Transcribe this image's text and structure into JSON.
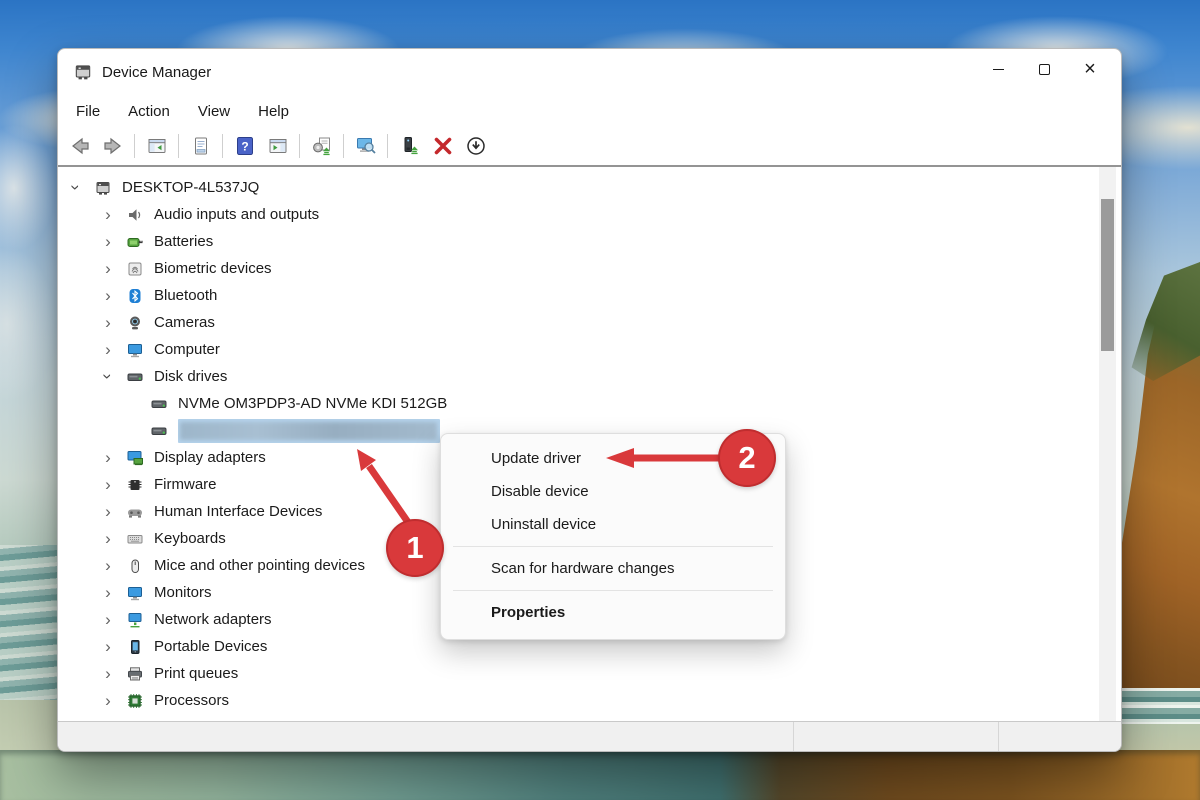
{
  "window": {
    "title": "Device Manager",
    "controls": [
      {
        "name": "minimize"
      },
      {
        "name": "maximize"
      },
      {
        "name": "close"
      }
    ]
  },
  "menu_bar": {
    "items": [
      {
        "label": "File"
      },
      {
        "label": "Action"
      },
      {
        "label": "View"
      },
      {
        "label": "Help"
      }
    ]
  },
  "toolbar": {
    "items": [
      {
        "type": "button",
        "icon": "back-icon"
      },
      {
        "type": "button",
        "icon": "forward-icon"
      },
      {
        "type": "separator"
      },
      {
        "type": "button",
        "icon": "show-console-tree-icon"
      },
      {
        "type": "separator"
      },
      {
        "type": "button",
        "icon": "properties-icon"
      },
      {
        "type": "separator"
      },
      {
        "type": "button",
        "icon": "help-icon"
      },
      {
        "type": "button",
        "icon": "action-pane-icon"
      },
      {
        "type": "separator"
      },
      {
        "type": "button",
        "icon": "update-driver-software-icon"
      },
      {
        "type": "separator"
      },
      {
        "type": "button",
        "icon": "scan-hardware-changes-icon"
      },
      {
        "type": "separator"
      },
      {
        "type": "button",
        "icon": "update-device-driver-icon"
      },
      {
        "type": "button",
        "icon": "uninstall-device-icon"
      },
      {
        "type": "button",
        "icon": "disable-device-icon"
      }
    ]
  },
  "device_tree": {
    "items": [
      {
        "label": "DESKTOP-4L537JQ",
        "level": 0,
        "icon": "computer-host-icon",
        "state": "expanded"
      },
      {
        "label": "Audio inputs and outputs",
        "level": 1,
        "icon": "audio-icon",
        "state": "collapsed"
      },
      {
        "label": "Batteries",
        "level": 1,
        "icon": "battery-icon",
        "state": "collapsed"
      },
      {
        "label": "Biometric devices",
        "level": 1,
        "icon": "biometric-icon",
        "state": "collapsed"
      },
      {
        "label": "Bluetooth",
        "level": 1,
        "icon": "bluetooth-icon",
        "state": "collapsed"
      },
      {
        "label": "Cameras",
        "level": 1,
        "icon": "camera-icon",
        "state": "collapsed"
      },
      {
        "label": "Computer",
        "level": 1,
        "icon": "computer-icon",
        "state": "collapsed"
      },
      {
        "label": "Disk drives",
        "level": 1,
        "icon": "disk-icon",
        "state": "expanded"
      },
      {
        "label": "NVMe OM3PDP3-AD NVMe KDI 512GB",
        "level": 2,
        "icon": "disk-icon",
        "state": "leaf"
      },
      {
        "label": "",
        "level": 2,
        "icon": "disk-icon",
        "state": "leaf",
        "selected": true,
        "redacted": true
      },
      {
        "label": "Display adapters",
        "level": 1,
        "icon": "display-adapter-icon",
        "state": "collapsed"
      },
      {
        "label": "Firmware",
        "level": 1,
        "icon": "firmware-icon",
        "state": "collapsed"
      },
      {
        "label": "Human Interface Devices",
        "level": 1,
        "icon": "hid-icon",
        "state": "collapsed"
      },
      {
        "label": "Keyboards",
        "level": 1,
        "icon": "keyboard-icon",
        "state": "collapsed"
      },
      {
        "label": "Mice and other pointing devices",
        "level": 1,
        "icon": "mouse-icon",
        "state": "collapsed"
      },
      {
        "label": "Monitors",
        "level": 1,
        "icon": "monitor-icon",
        "state": "collapsed"
      },
      {
        "label": "Network adapters",
        "level": 1,
        "icon": "network-icon",
        "state": "collapsed"
      },
      {
        "label": "Portable Devices",
        "level": 1,
        "icon": "portable-icon",
        "state": "collapsed"
      },
      {
        "label": "Print queues",
        "level": 1,
        "icon": "printer-icon",
        "state": "collapsed"
      },
      {
        "label": "Processors",
        "level": 1,
        "icon": "processor-icon",
        "state": "collapsed"
      }
    ]
  },
  "context_menu": {
    "items": [
      {
        "type": "item",
        "label": "Update driver"
      },
      {
        "type": "item",
        "label": "Disable device"
      },
      {
        "type": "item",
        "label": "Uninstall device"
      },
      {
        "type": "separator"
      },
      {
        "type": "item",
        "label": "Scan for hardware changes"
      },
      {
        "type": "separator"
      },
      {
        "type": "item",
        "label": "Properties",
        "bold": true
      }
    ]
  },
  "annotations": {
    "badges": [
      {
        "label": "1"
      },
      {
        "label": "2"
      }
    ],
    "accent_color": "#d9393b"
  },
  "colors": {
    "selection_highlight": "#b5d3ec",
    "annotation_red": "#d9393b",
    "toolbar_border": "#949494",
    "status_bar_bg": "#f0f0f0"
  }
}
